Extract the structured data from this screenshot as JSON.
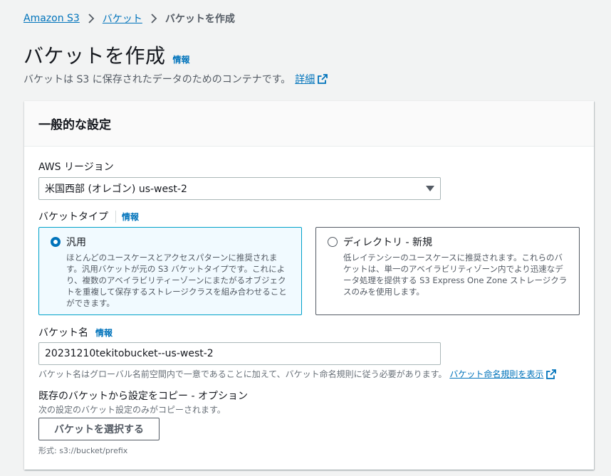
{
  "breadcrumb": {
    "items": [
      "Amazon S3",
      "バケット"
    ],
    "current": "バケットを作成"
  },
  "header": {
    "title": "バケットを作成",
    "info": "情報",
    "description": "バケットは S3 に保存されたデータのためのコンテナです。",
    "detail_link": "詳細"
  },
  "general": {
    "heading": "一般的な設定",
    "region_label": "AWS リージョン",
    "region_value": "米国西部 (オレゴン) us-west-2",
    "bucket_type_label": "バケットタイプ",
    "bucket_type_info": "情報",
    "bucket_types": [
      {
        "label": "汎用",
        "selected": true,
        "description": "ほとんどのユースケースとアクセスパターンに推奨されます。汎用バケットが元の S3 バケットタイプです。これにより、複数のアベイラビリティーゾーンにまたがるオブジェクトを重複して保存するストレージクラスを組み合わせることができます。"
      },
      {
        "label": "ディレクトリ - 新規",
        "selected": false,
        "description": "低レイテンシーのユースケースに推奨されます。これらのバケットは、単一のアベイラビリティゾーン内でより迅速なデータ処理を提供する S3 Express One Zone ストレージクラスのみを使用します。"
      }
    ],
    "bucket_name_label": "バケット名",
    "bucket_name_info": "情報",
    "bucket_name_value": "20231210tekitobucket--us-west-2",
    "bucket_name_hint": "バケット名はグローバル名前空間内で一意であることに加えて、バケット命名規則に従う必要があります。",
    "naming_rules_link": "バケット命名規則を表示",
    "copy_title": "既存のバケットから設定をコピー - オプション",
    "copy_desc": "次の設定のバケット設定のみがコピーされます。",
    "choose_bucket_button": "バケットを選択する",
    "format_hint": "形式: s3://bucket/prefix"
  },
  "colors": {
    "link": "#0073bb",
    "selected_border": "#00a1c9",
    "selected_bg": "#f1faff"
  }
}
